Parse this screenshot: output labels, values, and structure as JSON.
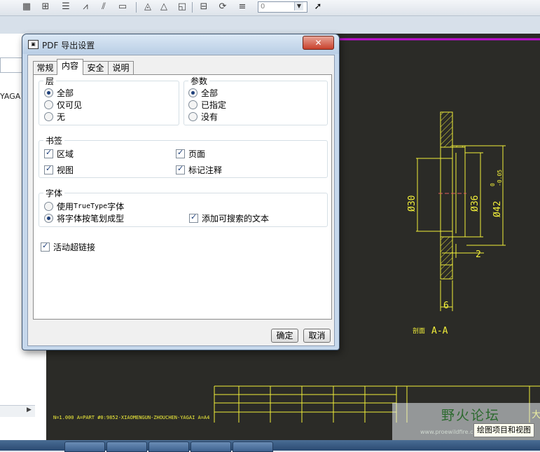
{
  "toolbar": {
    "icons": [
      "grid-icon",
      "snap-icon",
      "layer-icon",
      "measure-icon",
      "hatch-icon",
      "view-icon",
      "pan-icon",
      "zoom-icon",
      "shade-icon",
      "table-icon",
      "refresh-icon",
      "list-icon",
      "pointer-icon"
    ],
    "zoom_value": "0"
  },
  "left_pane": {
    "text": "YAGA"
  },
  "dialog": {
    "title": "PDF 导出设置",
    "close": "✕",
    "tabs": [
      "常规",
      "内容",
      "安全",
      "说明"
    ],
    "active_tab": 1,
    "layers": {
      "legend": "层",
      "options": [
        {
          "label": "全部",
          "selected": true
        },
        {
          "label": "仅可见",
          "selected": false
        },
        {
          "label": "无",
          "selected": false
        }
      ]
    },
    "params": {
      "legend": "参数",
      "options": [
        {
          "label": "全部",
          "selected": true
        },
        {
          "label": "已指定",
          "selected": false
        },
        {
          "label": "没有",
          "selected": false
        }
      ]
    },
    "bookmarks": {
      "legend": "书签",
      "items": [
        {
          "label": "区域",
          "checked": true
        },
        {
          "label": "页面",
          "checked": true
        },
        {
          "label": "视图",
          "checked": true
        },
        {
          "label": "标记注释",
          "checked": true
        }
      ]
    },
    "fonts": {
      "legend": "字体",
      "use_prefix": "使用 ",
      "use_mono": "TrueType",
      "use_suffix": " 字体",
      "stroke": "将字体按笔划成型",
      "stroke_selected": true,
      "searchable": "添加可搜索的文本",
      "searchable_checked": true
    },
    "hyperlinks": {
      "label": "活动超链接",
      "checked": true
    },
    "ok": "确定",
    "cancel": "取消"
  },
  "drawing": {
    "dim_30": "Ø30",
    "dim_36": "Ø36",
    "dim_42": "Ø42",
    "tol_upper": "0",
    "tol_lower": "-0.05",
    "dim_2": "2",
    "dim_6": "6",
    "section_prefix": "剖面",
    "section_label": "A-A",
    "footer": "N=1.000  A=PART  #0:9852-XIAOMENGUN-ZHOUCHEN-YAGAI  A=A4",
    "title_cell": "大"
  },
  "watermark": {
    "text": "野火论坛",
    "url": "www.proewildfire.cn"
  },
  "tooltip": "绘图项目和视图",
  "colors": {
    "drawing_bg": "#2b2b27",
    "line": "#f2ef3a",
    "border_magenta": "#c10fd6",
    "dialog_frame": "#c6d8ec",
    "close_red": "#c8402b"
  }
}
